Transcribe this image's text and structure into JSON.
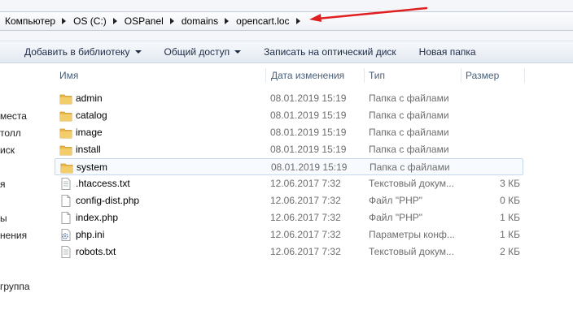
{
  "address_bar": {
    "crumbs": [
      "Компьютер",
      "OS (C:)",
      "OSPanel",
      "domains",
      "opencart.loc"
    ]
  },
  "toolbar": {
    "add_to_library": "Добавить в библиотеку",
    "share": "Общий доступ",
    "burn": "Записать на оптический диск",
    "new_folder": "Новая папка"
  },
  "nav": [
    "места",
    "толл",
    "иск",
    "я",
    "ы",
    "нения",
    "группа"
  ],
  "columns": {
    "name": "Имя",
    "date": "Дата изменения",
    "type": "Тип",
    "size": "Размер"
  },
  "files": [
    {
      "name": "admin",
      "date": "08.01.2019 15:19",
      "type": "Папка с файлами",
      "size": "",
      "icon": "folder-icon"
    },
    {
      "name": "catalog",
      "date": "08.01.2019 15:19",
      "type": "Папка с файлами",
      "size": "",
      "icon": "folder-icon"
    },
    {
      "name": "image",
      "date": "08.01.2019 15:19",
      "type": "Папка с файлами",
      "size": "",
      "icon": "folder-icon"
    },
    {
      "name": "install",
      "date": "08.01.2019 15:19",
      "type": "Папка с файлами",
      "size": "",
      "icon": "folder-icon"
    },
    {
      "name": "system",
      "date": "08.01.2019 15:19",
      "type": "Папка с файлами",
      "size": "",
      "icon": "folder-icon"
    },
    {
      "name": ".htaccess.txt",
      "date": "12.06.2017 7:32",
      "type": "Текстовый докум...",
      "size": "3 КБ",
      "icon": "text-file-icon"
    },
    {
      "name": "config-dist.php",
      "date": "12.06.2017 7:32",
      "type": "Файл \"PHP\"",
      "size": "0 КБ",
      "icon": "file-icon"
    },
    {
      "name": "index.php",
      "date": "12.06.2017 7:32",
      "type": "Файл \"PHP\"",
      "size": "1 КБ",
      "icon": "file-icon"
    },
    {
      "name": "php.ini",
      "date": "12.06.2017 7:32",
      "type": "Параметры конф...",
      "size": "1 КБ",
      "icon": "settings-file-icon"
    },
    {
      "name": "robots.txt",
      "date": "12.06.2017 7:32",
      "type": "Текстовый докум...",
      "size": "2 КБ",
      "icon": "text-file-icon"
    }
  ],
  "colors": {
    "annotation_arrow": "#e02020",
    "folder": "#e8b84a",
    "selection_border": "#c5d8ee"
  }
}
